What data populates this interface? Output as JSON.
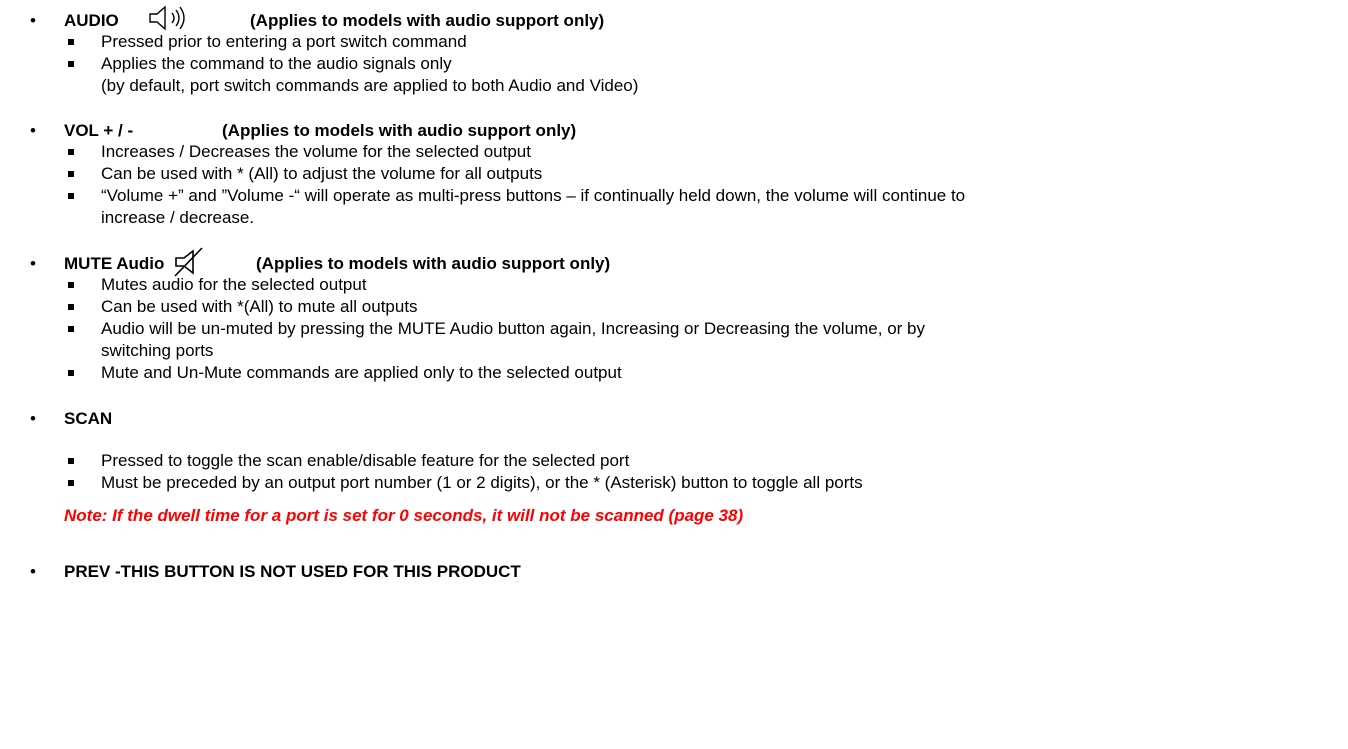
{
  "sections": [
    {
      "heading": "AUDIO",
      "note": "(Applies to models with audio support only)",
      "icon": "speaker-waves-icon",
      "items": [
        "Pressed prior to entering a port switch command",
        "Applies the command to the audio signals only"
      ],
      "continuation": "(by default, port switch commands are applied to both Audio and Video)"
    },
    {
      "heading": "VOL + / -",
      "note": "(Applies to models with audio support only)",
      "items": [
        "Increases / Decreases the volume for the selected output",
        "Can be used with * (All) to adjust the volume for all outputs",
        "“Volume +” and ”Volume -“ will operate as multi-press buttons – if continually held down, the volume will continue to"
      ],
      "continuation": "increase / decrease."
    },
    {
      "heading": "MUTE Audio",
      "note": "(Applies to models with audio support only)",
      "icon": "speaker-muted-icon",
      "items": [
        "Mutes audio for the selected output",
        "Can be used with *(All) to mute all outputs",
        "Audio will be un-muted by pressing the MUTE Audio button again, Increasing or Decreasing the volume, or by"
      ],
      "continuation": "switching ports",
      "items_after": [
        "Mute and Un-Mute commands are applied only to the selected output"
      ]
    },
    {
      "heading": "SCAN",
      "items": [
        "Pressed to toggle the scan enable/disable feature for the selected port",
        "Must be preceded by an output port number (1 or 2 digits),  or the * (Asterisk) button to toggle all ports"
      ],
      "warning": "Note: If the dwell time for a port is set for 0 seconds, it will not be scanned (page 38)"
    },
    {
      "heading": "PREV -THIS BUTTON IS NOT USED FOR THIS PRODUCT"
    }
  ],
  "colors": {
    "text": "#000000",
    "note": "#ff0000"
  }
}
